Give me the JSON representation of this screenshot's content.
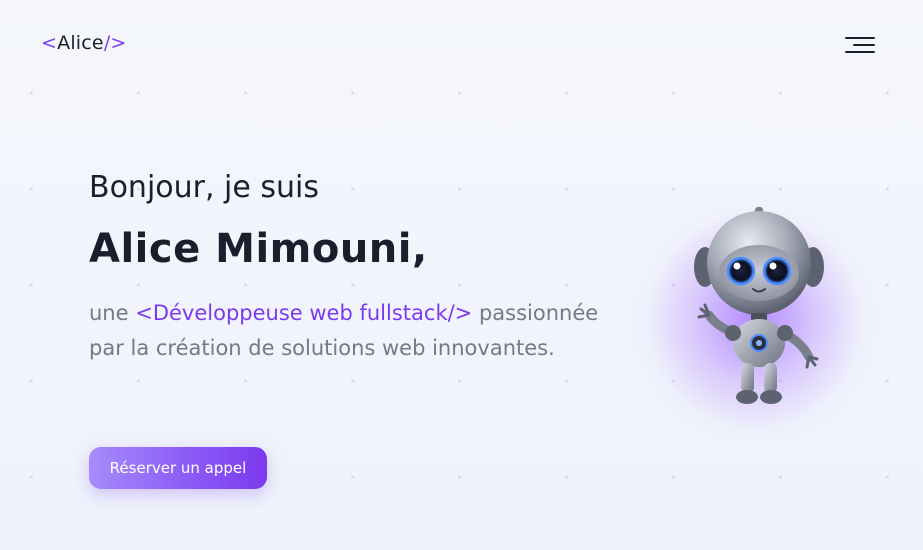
{
  "header": {
    "logo": {
      "open_bracket": "<",
      "name": "Alice",
      "close": "/>"
    },
    "menu_icon": "hamburger-menu-icon"
  },
  "hero": {
    "greeting": "Bonjour, je suis",
    "name": "Alice Mimouni,",
    "desc_prefix": "une",
    "role": "<Développeuse web fullstack/>",
    "desc_suffix": "passionnée par la création de solutions web innovantes.",
    "cta_label": "Réserver un appel"
  },
  "illustration": "robot-illustration",
  "colors": {
    "accent": "#7c3aed",
    "text": "#1a1f2e",
    "muted": "#727a89",
    "background": "#eff3fb"
  }
}
